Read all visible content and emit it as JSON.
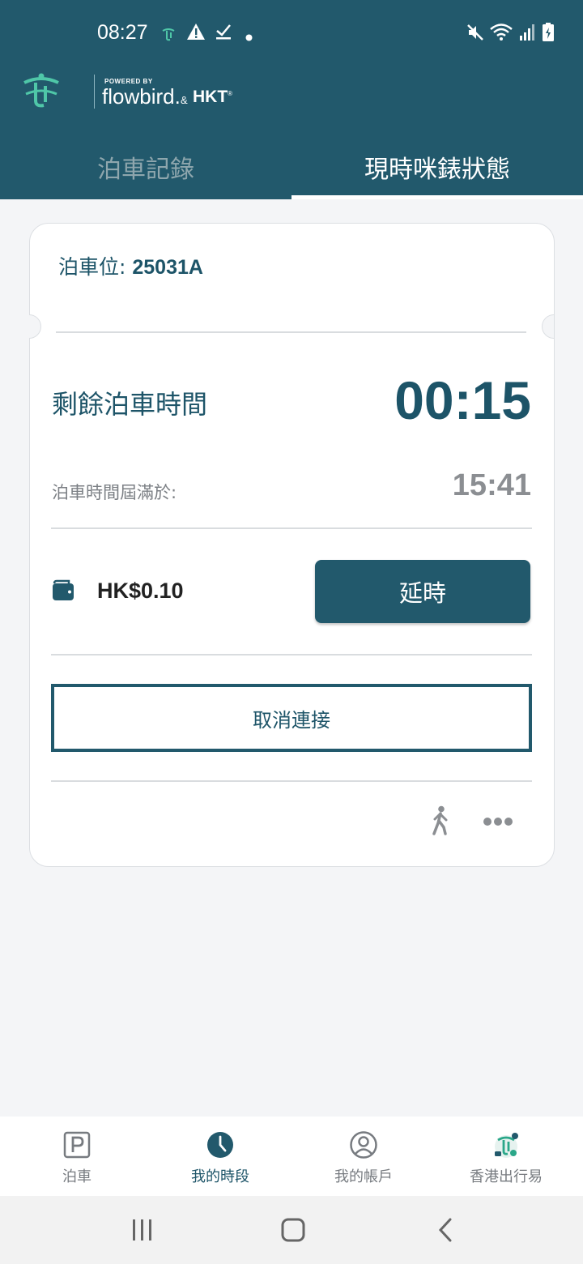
{
  "status_bar": {
    "time": "08:27"
  },
  "brand": {
    "powered_by": "POWERED BY",
    "name": "flowbird.",
    "amp": "&",
    "partner": "HKT",
    "registered": "®"
  },
  "tabs": [
    {
      "label": "泊車記錄",
      "active": false
    },
    {
      "label": "現時咪錶狀態",
      "active": true
    }
  ],
  "card": {
    "spot_label": "泊車位: ",
    "spot_value": "25031A",
    "remaining_label": "剩餘泊車時間",
    "remaining_value": "00:15",
    "expiry_label": "泊車時間屆滿於:",
    "expiry_value": "15:41",
    "balance": "HK$0.10",
    "extend_button": "延時",
    "disconnect_button": "取消連接"
  },
  "bottom_nav": [
    {
      "label": "泊車",
      "icon": "parking-icon",
      "active": false
    },
    {
      "label": "我的時段",
      "icon": "clock-icon",
      "active": true
    },
    {
      "label": "我的帳戶",
      "icon": "account-icon",
      "active": false
    },
    {
      "label": "香港出行易",
      "icon": "hk-mobility-icon",
      "active": false
    }
  ],
  "colors": {
    "primary": "#22596c",
    "background": "#f4f5f7",
    "text_primary": "#1d5468",
    "text_muted": "#8b8e92"
  }
}
